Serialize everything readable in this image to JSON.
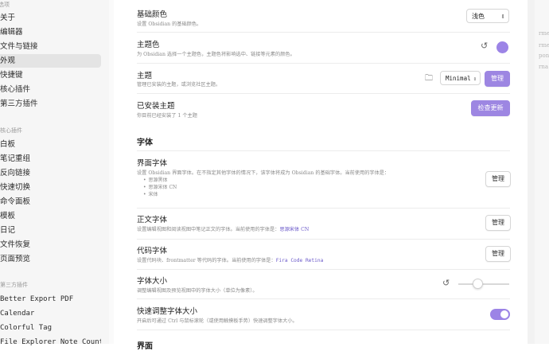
{
  "sidebar": {
    "section_options": "选项",
    "options": [
      "关于",
      "编辑器",
      "文件与链接",
      "外观",
      "快捷键",
      "核心插件",
      "第三方插件"
    ],
    "section_core": "核心插件",
    "core": [
      "白板",
      "笔记重组",
      "反向链接",
      "快速切换",
      "命令面板",
      "模板",
      "日记",
      "文件恢复",
      "页面预览"
    ],
    "section_third": "第三方插件",
    "third": [
      "Better Export PDF",
      "Calendar",
      "Colorful Tag",
      "File Explorer Note Count"
    ]
  },
  "settings": {
    "base_color": {
      "title": "基础颜色",
      "desc": "设置 Obsidian 的基础颜色。",
      "value": "浅色"
    },
    "accent_color": {
      "title": "主题色",
      "desc": "为 Obsidian 选择一个主题色，主题色将影响选中、链接等元素的颜色。",
      "color": "#9c84e6"
    },
    "themes": {
      "title": "主题",
      "desc": "管理已安装的主题，或浏览社区主题。",
      "value": "Minimal",
      "button": "管理"
    },
    "installed": {
      "title": "已安装主题",
      "desc": "你目前已经安装了 1 个主题",
      "button": "检查更新"
    },
    "font_heading": "字体",
    "ui_font": {
      "title": "界面字体",
      "desc": "设置 Obsidian 界面字体。在不指定其他字体的情况下，该字体将成为 Obsidian 的基础字体。当前使用的字体是：",
      "list": [
        "思源黑体",
        "思源宋体 CN",
        "宋体"
      ],
      "button": "管理"
    },
    "text_font": {
      "title": "正文字体",
      "desc": "设置编辑视图和阅读视图中笔记正文的字体。当前使用的字体是：",
      "value": "思源宋体 CN",
      "button": "管理"
    },
    "code_font": {
      "title": "代码字体",
      "desc": "设置代码块、frontmatter 等代码的字体。当前使用的字体是：",
      "value": "Fira Code Retina",
      "button": "管理"
    },
    "font_size": {
      "title": "字体大小",
      "desc": "调整编辑视图及预览视图中的字体大小（单位为像素）。",
      "level": 0.38
    },
    "quick_font": {
      "title": "快速调整字体大小",
      "desc": "开启后可通过 Ctrl 与鼠标滚轮（或使用触摸板手势）快速调整字体大小。",
      "enabled": true
    },
    "next_heading": "界面"
  },
  "right_panel": [
    "rmen",
    "rmen",
    "pon",
    "rna"
  ],
  "colors": {
    "accent": "#9c84e6"
  }
}
